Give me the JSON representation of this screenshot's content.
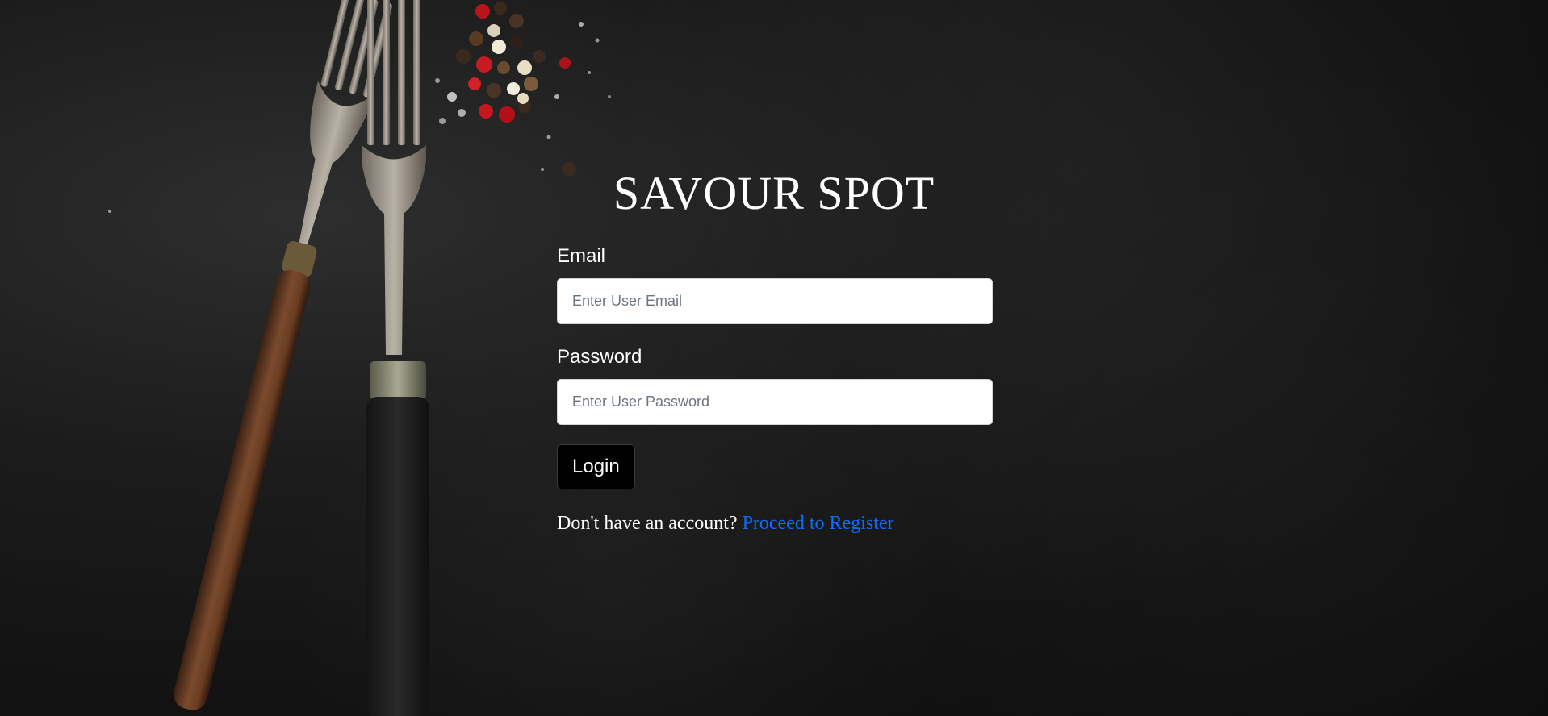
{
  "app": {
    "title": "SAVOUR SPOT"
  },
  "login_form": {
    "email_label": "Email",
    "email_placeholder": "Enter User Email",
    "email_value": "",
    "password_label": "Password",
    "password_placeholder": "Enter User Password",
    "password_value": "",
    "login_button": "Login",
    "register_prompt": "Don't have an account?",
    "register_link": "Proceed to Register"
  },
  "icons": [
    "fork-left",
    "fork-right",
    "peppercorns"
  ],
  "colors": {
    "background": "#141414",
    "link": "#0d6efd",
    "button": "#000000",
    "text": "#ffffff"
  }
}
